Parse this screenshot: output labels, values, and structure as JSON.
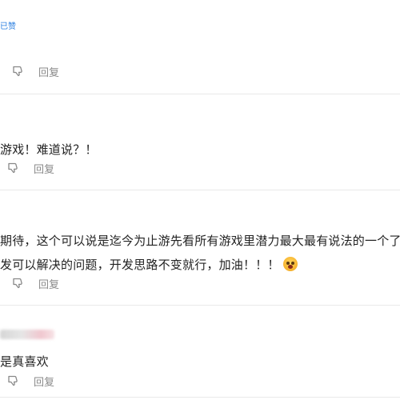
{
  "comments": [
    {
      "tag": "已赞",
      "reply_label": "回复"
    },
    {
      "text": "游戏！难道说？！",
      "reply_label": "回复"
    },
    {
      "text_line1": "期待，这个可以说是迄今为止游先看所有游戏里潜力最大最有说法的一个了，",
      "text_line2": "发可以解决的问题，开发思路不变就行，加油！！！",
      "emoji": "face-screaming",
      "reply_label": "回复"
    },
    {
      "text": "是真喜欢",
      "reply_label": "回复"
    }
  ],
  "icons": {
    "dislike": "thumbs-down-icon"
  },
  "colors": {
    "tag": "#2b7fe0",
    "reply": "#8a8a8a",
    "divider": "#e9e9e9"
  }
}
